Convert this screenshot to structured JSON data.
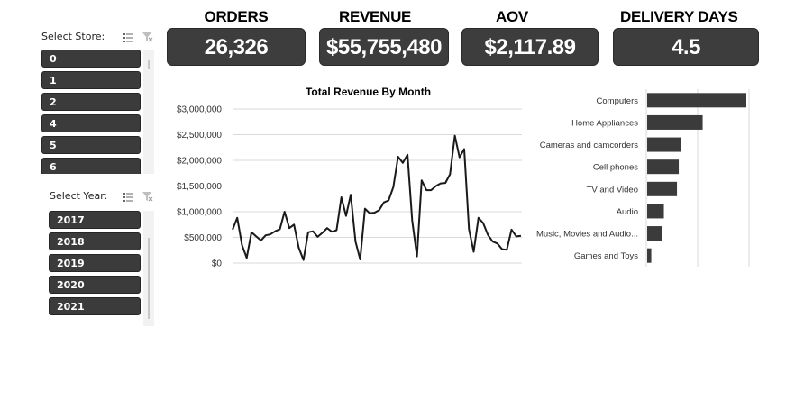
{
  "store_slicer": {
    "title": "Select Store:",
    "items": [
      "0",
      "1",
      "2",
      "4",
      "5",
      "6"
    ]
  },
  "year_slicer": {
    "title": "Select Year:",
    "items": [
      "2017",
      "2018",
      "2019",
      "2020",
      "2021"
    ]
  },
  "icons": {
    "multi_select": "multi-select-icon",
    "clear_filter": "clear-filter-icon"
  },
  "kpis": {
    "orders": {
      "label": "ORDERS",
      "value": "26,326"
    },
    "revenue": {
      "label": "REVENUE",
      "value": "$55,755,480"
    },
    "aov": {
      "label": "AOV",
      "value": "$2,117.89"
    },
    "delivery_days": {
      "label": "DELIVERY DAYS",
      "value": "4.5"
    }
  },
  "colors": {
    "card": "#3d3d3d",
    "line": "#1a1a1a",
    "bar": "#3b3b3b",
    "grid": "#d9d9d9"
  },
  "chart_data": [
    {
      "type": "line",
      "title": "Total Revenue By Month",
      "ylim": [
        0,
        3000000
      ],
      "y_ticks": [
        0,
        500000,
        1000000,
        1500000,
        2000000,
        2500000,
        3000000
      ],
      "y_tick_labels": [
        "$0",
        "$500,000",
        "$1,000,000",
        "$1,500,000",
        "$2,000,000",
        "$2,500,000",
        "$3,000,000"
      ],
      "grid": true,
      "values": [
        650000,
        880000,
        350000,
        100000,
        600000,
        520000,
        440000,
        540000,
        560000,
        620000,
        660000,
        1000000,
        680000,
        750000,
        300000,
        60000,
        600000,
        620000,
        510000,
        590000,
        680000,
        610000,
        640000,
        1280000,
        920000,
        1330000,
        420000,
        70000,
        1060000,
        970000,
        980000,
        1030000,
        1180000,
        1220000,
        1480000,
        2070000,
        1950000,
        2110000,
        830000,
        130000,
        1610000,
        1420000,
        1420000,
        1500000,
        1550000,
        1560000,
        1730000,
        2480000,
        2060000,
        2220000,
        660000,
        220000,
        880000,
        780000,
        550000,
        420000,
        380000,
        270000,
        260000,
        650000,
        520000,
        530000
      ]
    },
    {
      "type": "bar",
      "orientation": "horizontal",
      "categories": [
        "Computers",
        "Home Appliances",
        "Cameras and camcorders",
        "Cell phones",
        "TV and Video",
        "Audio",
        "Music, Movies and Audio...",
        "Games and Toys"
      ],
      "values": [
        19300000,
        10800000,
        6500000,
        6150000,
        5800000,
        3250000,
        2950000,
        800000
      ],
      "xlim": [
        0,
        20000000
      ],
      "grid": true
    }
  ]
}
